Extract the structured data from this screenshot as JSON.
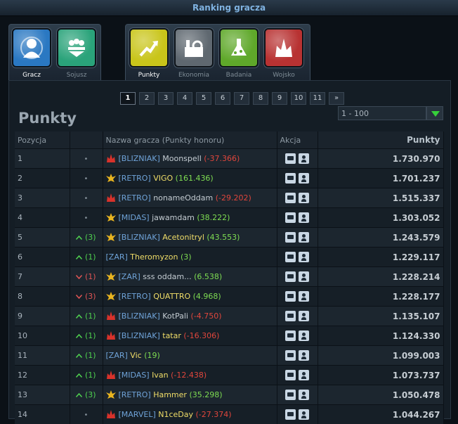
{
  "window_title": "Ranking gracza",
  "category_tabs": [
    {
      "label": "Gracz",
      "icon": "player-icon",
      "color": "#2a78c2"
    },
    {
      "label": "Sojusz",
      "icon": "alliance-icon",
      "color": "#2aa37a"
    }
  ],
  "ranking_tabs": [
    {
      "label": "Punkty",
      "icon": "points-icon",
      "color": "#c9c51a"
    },
    {
      "label": "Ekonomia",
      "icon": "economy-icon",
      "color": "#5f6870"
    },
    {
      "label": "Badania",
      "icon": "research-icon",
      "color": "#5fa82a"
    },
    {
      "label": "Wojsko",
      "icon": "military-icon",
      "color": "#b83232"
    }
  ],
  "pagination": {
    "pages": [
      "1",
      "2",
      "3",
      "4",
      "5",
      "6",
      "7",
      "8",
      "9",
      "10",
      "11"
    ],
    "current": "1",
    "next": "»"
  },
  "heading": "Punkty",
  "range_select": {
    "value": "1 - 100"
  },
  "table": {
    "columns": [
      "Pozycja",
      "",
      "Nazwa gracza (Punkty honoru)",
      "Akcja",
      "Punkty"
    ],
    "rows": [
      {
        "pos": "1",
        "change": "•",
        "dir": "none",
        "race": "red",
        "tag": "[BLIZNIAK]",
        "name": "Moonspell",
        "name_gold": false,
        "honor": "(-37.366)",
        "honor_sign": "neg",
        "points": "1.730.970"
      },
      {
        "pos": "2",
        "change": "•",
        "dir": "none",
        "race": "gold",
        "tag": "[RETRO]",
        "name": "VIGO",
        "name_gold": true,
        "honor": "(161.436)",
        "honor_sign": "pos",
        "points": "1.701.237"
      },
      {
        "pos": "3",
        "change": "•",
        "dir": "none",
        "race": "red",
        "tag": "[RETRO]",
        "name": "nonameOddam",
        "name_gold": false,
        "honor": "(-29.202)",
        "honor_sign": "neg",
        "points": "1.515.337"
      },
      {
        "pos": "4",
        "change": "•",
        "dir": "none",
        "race": "gold",
        "tag": "[MIDAS]",
        "name": "jawamdam",
        "name_gold": false,
        "honor": "(38.222)",
        "honor_sign": "pos",
        "points": "1.303.052"
      },
      {
        "pos": "5",
        "change": "(3)",
        "dir": "up",
        "race": "gold",
        "tag": "[BLIZNIAK]",
        "name": "Acetonitryl",
        "name_gold": true,
        "honor": "(43.553)",
        "honor_sign": "pos",
        "points": "1.243.579"
      },
      {
        "pos": "6",
        "change": "(1)",
        "dir": "up",
        "race": "",
        "tag": "[ZAR]",
        "name": "Theromyzon",
        "name_gold": true,
        "honor": "(3)",
        "honor_sign": "pos",
        "points": "1.229.117"
      },
      {
        "pos": "7",
        "change": "(1)",
        "dir": "down",
        "race": "gold",
        "tag": "[ZAR]",
        "name": "sss oddam...",
        "name_gold": false,
        "honor": "(6.538)",
        "honor_sign": "pos",
        "points": "1.228.214"
      },
      {
        "pos": "8",
        "change": "(3)",
        "dir": "down",
        "race": "gold",
        "tag": "[RETRO]",
        "name": "QUATTRO",
        "name_gold": true,
        "honor": "(4.968)",
        "honor_sign": "pos",
        "points": "1.228.177"
      },
      {
        "pos": "9",
        "change": "(1)",
        "dir": "up",
        "race": "red",
        "tag": "[BLIZNIAK]",
        "name": "KotPali",
        "name_gold": false,
        "honor": "(-4.750)",
        "honor_sign": "neg",
        "points": "1.135.107"
      },
      {
        "pos": "10",
        "change": "(1)",
        "dir": "up",
        "race": "red",
        "tag": "[BLIZNIAK]",
        "name": "tatar",
        "name_gold": true,
        "honor": "(-16.306)",
        "honor_sign": "neg",
        "points": "1.124.330"
      },
      {
        "pos": "11",
        "change": "(1)",
        "dir": "up",
        "race": "",
        "tag": "[ZAR]",
        "name": "Vic",
        "name_gold": true,
        "honor": "(19)",
        "honor_sign": "pos",
        "points": "1.099.003"
      },
      {
        "pos": "12",
        "change": "(1)",
        "dir": "up",
        "race": "red",
        "tag": "[MIDAS]",
        "name": "Ivan",
        "name_gold": true,
        "honor": "(-12.438)",
        "honor_sign": "neg",
        "points": "1.073.737"
      },
      {
        "pos": "13",
        "change": "(3)",
        "dir": "up",
        "race": "gold",
        "tag": "[RETRO]",
        "name": "Hammer",
        "name_gold": true,
        "honor": "(35.298)",
        "honor_sign": "pos",
        "points": "1.050.478"
      },
      {
        "pos": "14",
        "change": "•",
        "dir": "none",
        "race": "red",
        "tag": "[MARVEL]",
        "name": "N1ceDay",
        "name_gold": true,
        "honor": "(-27.374)",
        "honor_sign": "neg",
        "points": "1.044.267"
      }
    ]
  }
}
